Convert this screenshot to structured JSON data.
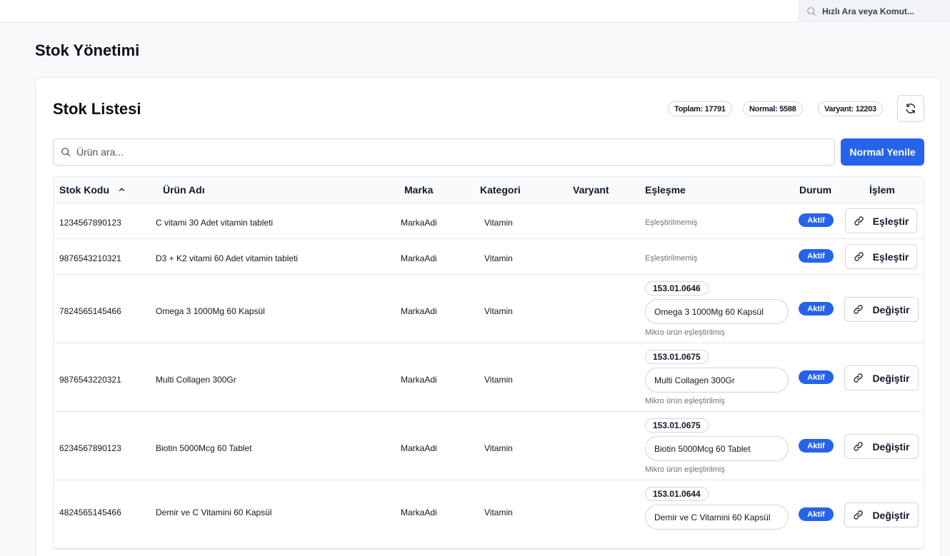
{
  "topbar": {
    "quick_search_placeholder": "Hızlı Ara veya Komut..."
  },
  "page": {
    "title": "Stok Yönetimi"
  },
  "card": {
    "title": "Stok Listesi",
    "badges": {
      "total": "Toplam: 17791",
      "normal": "Normal: 5588",
      "variant": "Varyant: 12203"
    },
    "search_placeholder": "Ürün ara...",
    "primary_button": "Normal Yenile"
  },
  "table": {
    "columns": {
      "code": "Stok Kodu",
      "name": "Ürün Adı",
      "brand": "Marka",
      "category": "Kategori",
      "variant": "Varyant",
      "match": "Eşleşme",
      "status": "Durum",
      "action": "İşlem"
    },
    "sort_indicator": "^",
    "rows": [
      {
        "code": "1234567890123",
        "name": "C vitami 30 Adet vitamin tableti",
        "brand": "MarkaAdi",
        "category": "Vitamin",
        "match_text": "Eşleştirilmemiş",
        "status": "Aktif",
        "action": "Eşleştir"
      },
      {
        "code": "9876543210321",
        "name": "D3 + K2 vitami 60 Adet vitamin tableti",
        "brand": "MarkaAdi",
        "category": "Vitamin",
        "match_text": "Eşleştirilmemiş",
        "status": "Aktif",
        "action": "Eşleştir"
      },
      {
        "code": "7824565145466",
        "name": "Omega 3 1000Mg 60 Kapsül",
        "brand": "MarkaAdi",
        "category": "Vitamin",
        "match_code": "153.01.0646",
        "match_product": "Omega 3 1000Mg 60 Kapsül",
        "match_note": "Mikro ürün eşleştirilmiş",
        "status": "Aktif",
        "action": "Değiştir"
      },
      {
        "code": "9876543220321",
        "name": "Multi Collagen 300Gr",
        "brand": "MarkaAdi",
        "category": "Vitamin",
        "match_code": "153.01.0675",
        "match_product": "Multi Collagen 300Gr",
        "match_note": "Mikro ürün eşleştirilmiş",
        "status": "Aktif",
        "action": "Değiştir"
      },
      {
        "code": "6234567890123",
        "name": "Biotin 5000Mcg 60 Tablet",
        "brand": "MarkaAdi",
        "category": "Vitamin",
        "match_code": "153.01.0675",
        "match_product": "Biotin 5000Mcg 60 Tablet",
        "match_note": "Mikro ürün eşleştirilmiş",
        "status": "Aktif",
        "action": "Değiştir"
      },
      {
        "code": "4824565145466",
        "name": "Demir ve C Vitamini 60 Kapsül",
        "brand": "MarkaAdi",
        "category": "Vitamin",
        "match_code": "153.01.0644",
        "match_product": "Demir ve C Vitamini 60 Kapsül",
        "status": "Aktif",
        "action": "Değiştir"
      }
    ]
  },
  "colors": {
    "primary": "#2563eb",
    "border": "#e5e7eb",
    "muted_text": "#6b7280"
  },
  "icons": {
    "search": "search-icon",
    "refresh": "refresh-icon",
    "link": "link-icon",
    "sort": "chevron-up-icon"
  }
}
